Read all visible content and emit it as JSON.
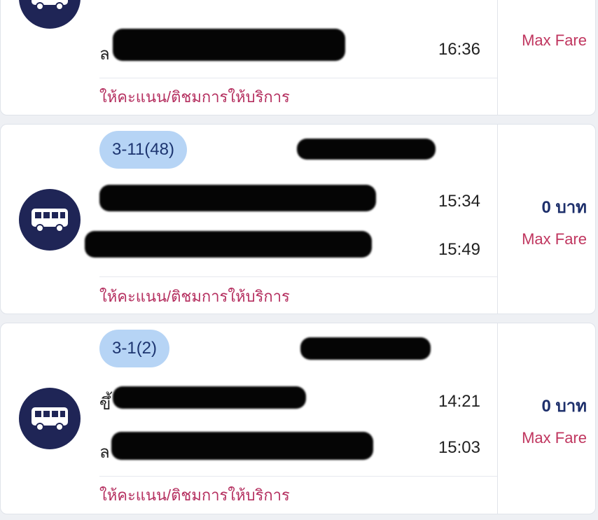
{
  "colors": {
    "bus_circle": "#1f2556",
    "route_pill_bg": "#b6d4f5",
    "link_color": "#b53060",
    "fare_color": "#1d2f6b",
    "max_fare_color": "#c0365f"
  },
  "trips": [
    {
      "route": "",
      "board_prefix": "",
      "board_time": "",
      "alight_prefix": "ล",
      "alight_time": "16:36",
      "fare": "",
      "max_fare_label": "Max Fare",
      "rate_label": "ให้คะแนน/ติชมการให้บริการ",
      "icon": "bus-icon"
    },
    {
      "route": "3-11(48)",
      "board_prefix": "",
      "board_time": "15:34",
      "alight_prefix": "",
      "alight_time": "15:49",
      "fare": "0 บาท",
      "max_fare_label": "Max Fare",
      "rate_label": "ให้คะแนน/ติชมการให้บริการ",
      "icon": "bus-icon"
    },
    {
      "route": "3-1(2)",
      "board_prefix": "ขึ้",
      "board_time": "14:21",
      "alight_prefix": "ล",
      "alight_time": "15:03",
      "fare": "0 บาท",
      "max_fare_label": "Max Fare",
      "rate_label": "ให้คะแนน/ติชมการให้บริการ",
      "icon": "bus-icon"
    }
  ]
}
